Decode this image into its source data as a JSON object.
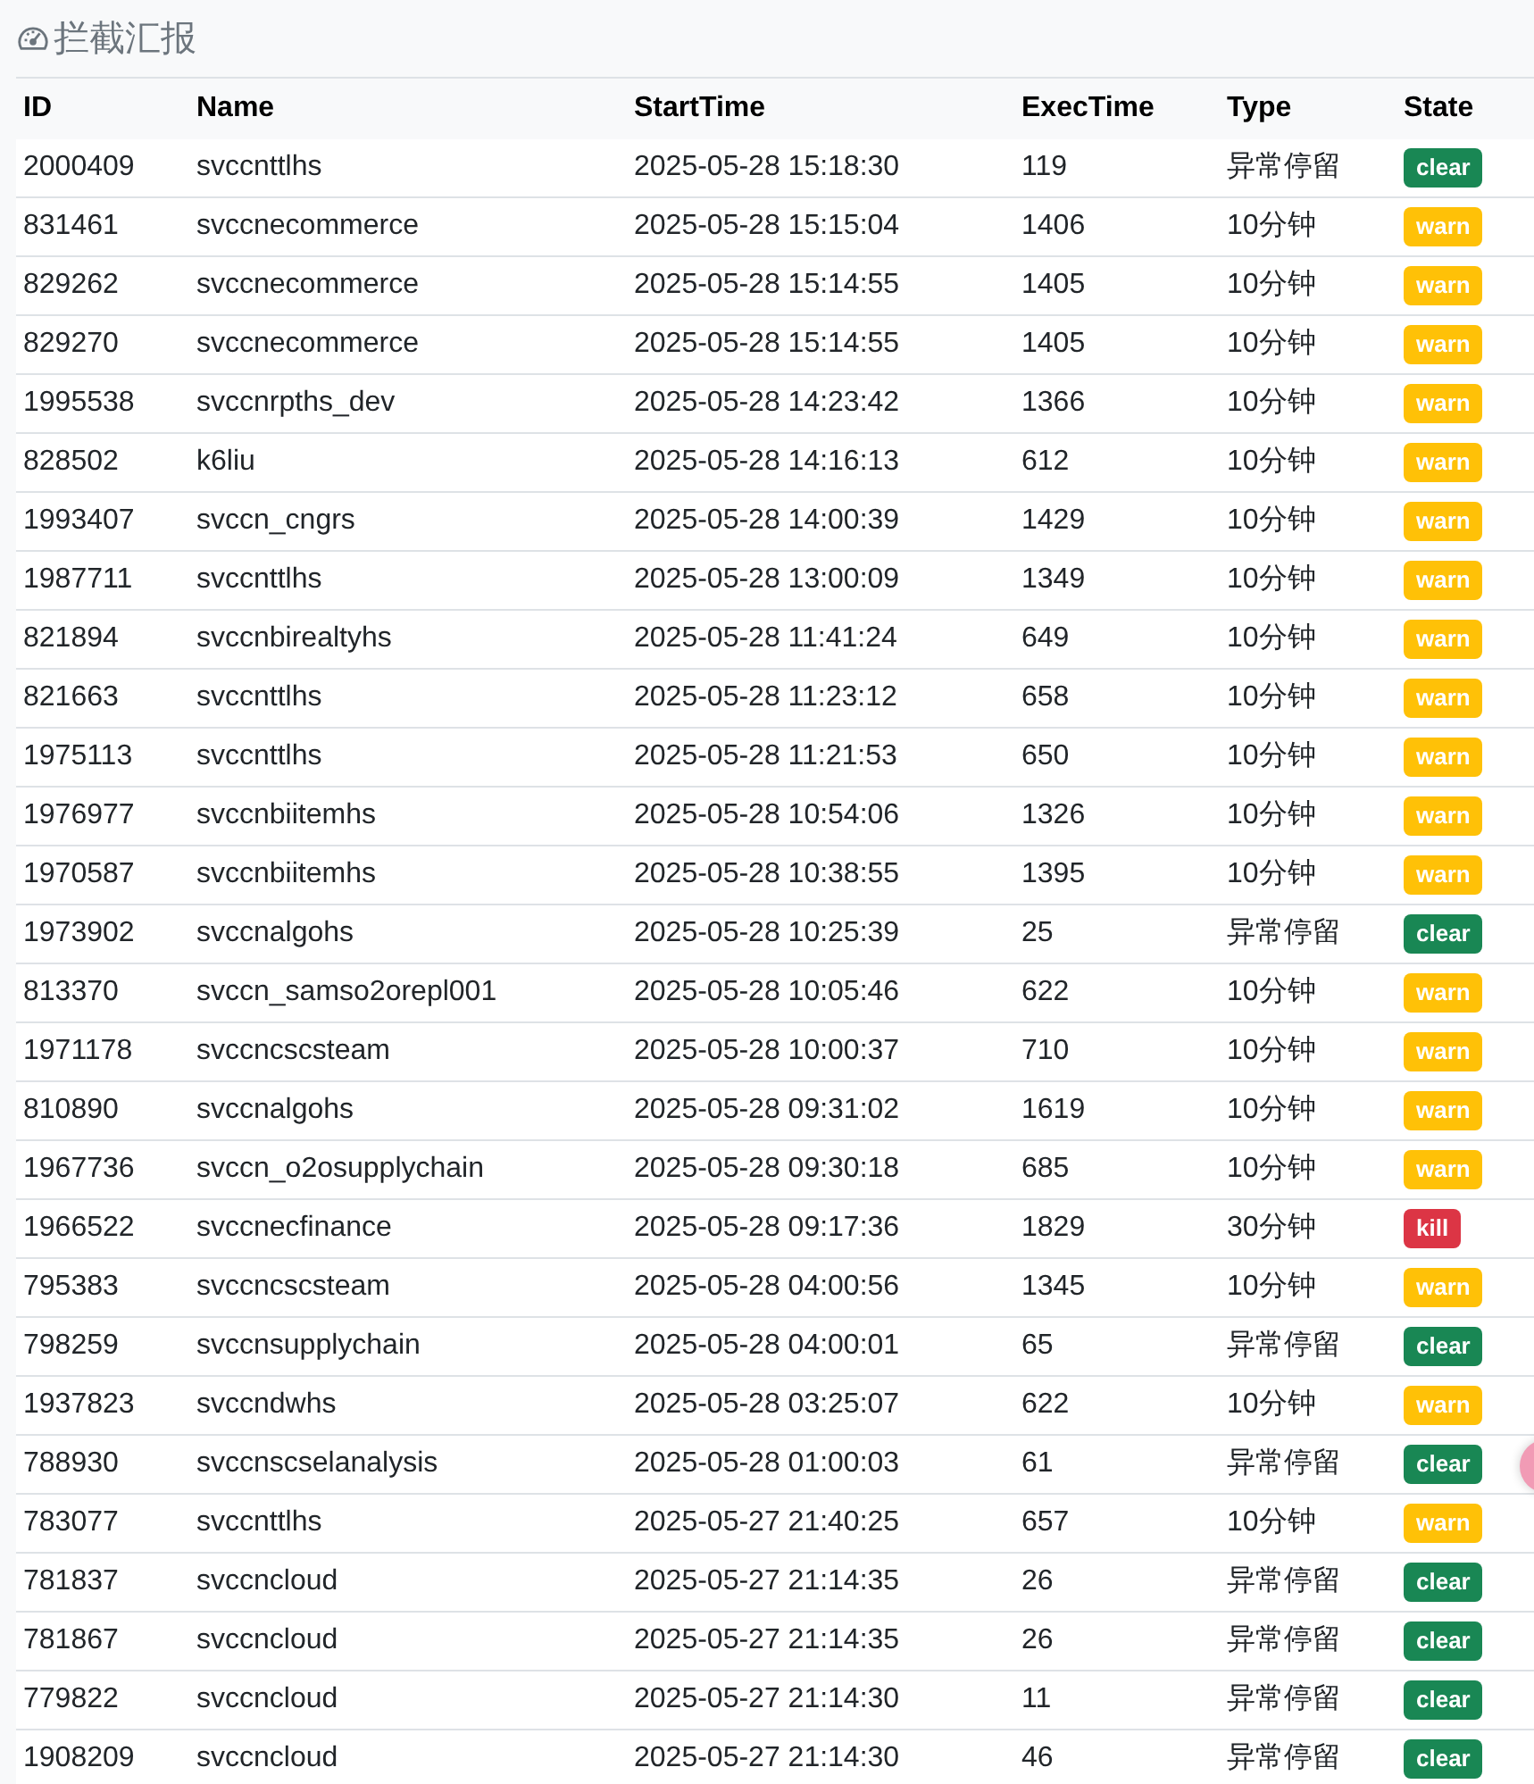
{
  "title": "拦截汇报",
  "table": {
    "columns": [
      "ID",
      "Name",
      "StartTime",
      "ExecTime",
      "Type",
      "State"
    ],
    "rows": [
      {
        "id": "2000409",
        "name": "svccnttlhs",
        "start": "2025-05-28 15:18:30",
        "exec": "119",
        "type": "异常停留",
        "state": "clear",
        "kind": "clear"
      },
      {
        "id": "831461",
        "name": "svccnecommerce",
        "start": "2025-05-28 15:15:04",
        "exec": "1406",
        "type": "10分钟",
        "state": "warn",
        "kind": "warn"
      },
      {
        "id": "829262",
        "name": "svccnecommerce",
        "start": "2025-05-28 15:14:55",
        "exec": "1405",
        "type": "10分钟",
        "state": "warn",
        "kind": "warn"
      },
      {
        "id": "829270",
        "name": "svccnecommerce",
        "start": "2025-05-28 15:14:55",
        "exec": "1405",
        "type": "10分钟",
        "state": "warn",
        "kind": "warn"
      },
      {
        "id": "1995538",
        "name": "svccnrpths_dev",
        "start": "2025-05-28 14:23:42",
        "exec": "1366",
        "type": "10分钟",
        "state": "warn",
        "kind": "warn"
      },
      {
        "id": "828502",
        "name": "k6liu",
        "start": "2025-05-28 14:16:13",
        "exec": "612",
        "type": "10分钟",
        "state": "warn",
        "kind": "warn"
      },
      {
        "id": "1993407",
        "name": "svccn_cngrs",
        "start": "2025-05-28 14:00:39",
        "exec": "1429",
        "type": "10分钟",
        "state": "warn",
        "kind": "warn"
      },
      {
        "id": "1987711",
        "name": "svccnttlhs",
        "start": "2025-05-28 13:00:09",
        "exec": "1349",
        "type": "10分钟",
        "state": "warn",
        "kind": "warn"
      },
      {
        "id": "821894",
        "name": "svccnbirealtyhs",
        "start": "2025-05-28 11:41:24",
        "exec": "649",
        "type": "10分钟",
        "state": "warn",
        "kind": "warn"
      },
      {
        "id": "821663",
        "name": "svccnttlhs",
        "start": "2025-05-28 11:23:12",
        "exec": "658",
        "type": "10分钟",
        "state": "warn",
        "kind": "warn"
      },
      {
        "id": "1975113",
        "name": "svccnttlhs",
        "start": "2025-05-28 11:21:53",
        "exec": "650",
        "type": "10分钟",
        "state": "warn",
        "kind": "warn"
      },
      {
        "id": "1976977",
        "name": "svccnbiitemhs",
        "start": "2025-05-28 10:54:06",
        "exec": "1326",
        "type": "10分钟",
        "state": "warn",
        "kind": "warn"
      },
      {
        "id": "1970587",
        "name": "svccnbiitemhs",
        "start": "2025-05-28 10:38:55",
        "exec": "1395",
        "type": "10分钟",
        "state": "warn",
        "kind": "warn"
      },
      {
        "id": "1973902",
        "name": "svccnalgohs",
        "start": "2025-05-28 10:25:39",
        "exec": "25",
        "type": "异常停留",
        "state": "clear",
        "kind": "clear"
      },
      {
        "id": "813370",
        "name": "svccn_samso2orepl001",
        "start": "2025-05-28 10:05:46",
        "exec": "622",
        "type": "10分钟",
        "state": "warn",
        "kind": "warn"
      },
      {
        "id": "1971178",
        "name": "svccncscsteam",
        "start": "2025-05-28 10:00:37",
        "exec": "710",
        "type": "10分钟",
        "state": "warn",
        "kind": "warn"
      },
      {
        "id": "810890",
        "name": "svccnalgohs",
        "start": "2025-05-28 09:31:02",
        "exec": "1619",
        "type": "10分钟",
        "state": "warn",
        "kind": "warn"
      },
      {
        "id": "1967736",
        "name": "svccn_o2osupplychain",
        "start": "2025-05-28 09:30:18",
        "exec": "685",
        "type": "10分钟",
        "state": "warn",
        "kind": "warn"
      },
      {
        "id": "1966522",
        "name": "svccnecfinance",
        "start": "2025-05-28 09:17:36",
        "exec": "1829",
        "type": "30分钟",
        "state": "kill",
        "kind": "kill"
      },
      {
        "id": "795383",
        "name": "svccncscsteam",
        "start": "2025-05-28 04:00:56",
        "exec": "1345",
        "type": "10分钟",
        "state": "warn",
        "kind": "warn"
      },
      {
        "id": "798259",
        "name": "svccnsupplychain",
        "start": "2025-05-28 04:00:01",
        "exec": "65",
        "type": "异常停留",
        "state": "clear",
        "kind": "clear"
      },
      {
        "id": "1937823",
        "name": "svccndwhs",
        "start": "2025-05-28 03:25:07",
        "exec": "622",
        "type": "10分钟",
        "state": "warn",
        "kind": "warn"
      },
      {
        "id": "788930",
        "name": "svccnscselanalysis",
        "start": "2025-05-28 01:00:03",
        "exec": "61",
        "type": "异常停留",
        "state": "clear",
        "kind": "clear"
      },
      {
        "id": "783077",
        "name": "svccnttlhs",
        "start": "2025-05-27 21:40:25",
        "exec": "657",
        "type": "10分钟",
        "state": "warn",
        "kind": "warn"
      },
      {
        "id": "781837",
        "name": "svccncloud",
        "start": "2025-05-27 21:14:35",
        "exec": "26",
        "type": "异常停留",
        "state": "clear",
        "kind": "clear"
      },
      {
        "id": "781867",
        "name": "svccncloud",
        "start": "2025-05-27 21:14:35",
        "exec": "26",
        "type": "异常停留",
        "state": "clear",
        "kind": "clear"
      },
      {
        "id": "779822",
        "name": "svccncloud",
        "start": "2025-05-27 21:14:30",
        "exec": "11",
        "type": "异常停留",
        "state": "clear",
        "kind": "clear"
      },
      {
        "id": "1908209",
        "name": "svccncloud",
        "start": "2025-05-27 21:14:30",
        "exec": "46",
        "type": "异常停留",
        "state": "clear",
        "kind": "clear"
      }
    ]
  }
}
